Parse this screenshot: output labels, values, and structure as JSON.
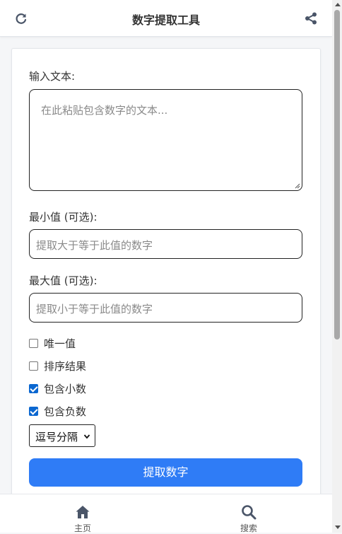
{
  "header": {
    "title": "数字提取工具"
  },
  "form": {
    "input_label": "输入文本:",
    "input_placeholder": "在此粘贴包含数字的文本...",
    "min_label": "最小值 (可选):",
    "min_placeholder": "提取大于等于此值的数字",
    "max_label": "最大值 (可选):",
    "max_placeholder": "提取小于等于此值的数字",
    "options": [
      {
        "label": "唯一值",
        "checked": false
      },
      {
        "label": "排序结果",
        "checked": false
      },
      {
        "label": "包含小数",
        "checked": true
      },
      {
        "label": "包含负数",
        "checked": true
      }
    ],
    "separator_selected": "逗号分隔",
    "extract_button": "提取数字"
  },
  "nav": {
    "items": [
      {
        "label": "主页",
        "icon": "home-icon"
      },
      {
        "label": "搜索",
        "icon": "search-icon"
      }
    ]
  },
  "colors": {
    "primary": "#2f7cf6",
    "checkbox": "#0b67d0",
    "nav_icon": "#4a5568"
  }
}
